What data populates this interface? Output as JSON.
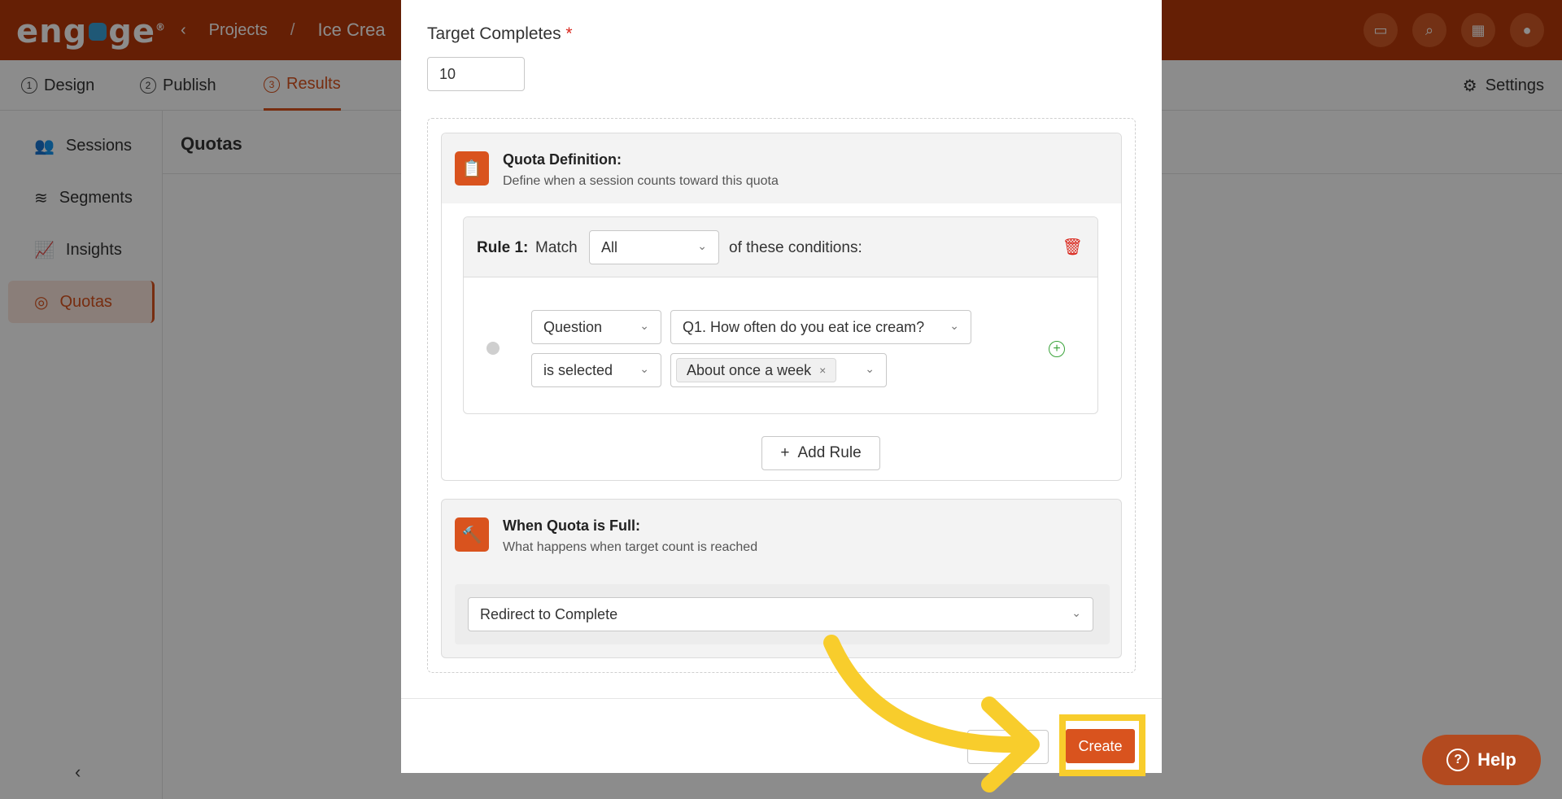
{
  "header": {
    "logo": "eng ge",
    "breadcrumb_back": "Projects",
    "breadcrumb_sep": "/",
    "project_name": "Ice Crea"
  },
  "tabs": [
    {
      "num": "1",
      "label": "Design"
    },
    {
      "num": "2",
      "label": "Publish"
    },
    {
      "num": "3",
      "label": "Results"
    }
  ],
  "settings_label": "Settings",
  "sidebar": {
    "items": [
      {
        "label": "Sessions"
      },
      {
        "label": "Segments"
      },
      {
        "label": "Insights"
      },
      {
        "label": "Quotas"
      }
    ]
  },
  "main": {
    "title": "Quotas"
  },
  "modal": {
    "target_label": "Target Completes",
    "required_mark": "*",
    "target_value": "10",
    "definition": {
      "title": "Quota Definition:",
      "subtitle": "Define when a session counts toward this quota"
    },
    "rule": {
      "label": "Rule 1:",
      "match_label": "Match",
      "match_value": "All",
      "conditions_label": "of these conditions:",
      "field_type": "Question",
      "question": "Q1. How often do you eat ice cream?",
      "operator": "is selected",
      "answer_chip": "About once a week"
    },
    "add_rule_label": "Add Rule",
    "full": {
      "title": "When Quota is Full:",
      "subtitle": "What happens when target count is reached",
      "action": "Redirect to Complete"
    },
    "create_label": "Create"
  },
  "help_label": "Help",
  "colors": {
    "brand": "#b8390a",
    "accent": "#d9531e",
    "highlight": "#f8cd2c"
  }
}
